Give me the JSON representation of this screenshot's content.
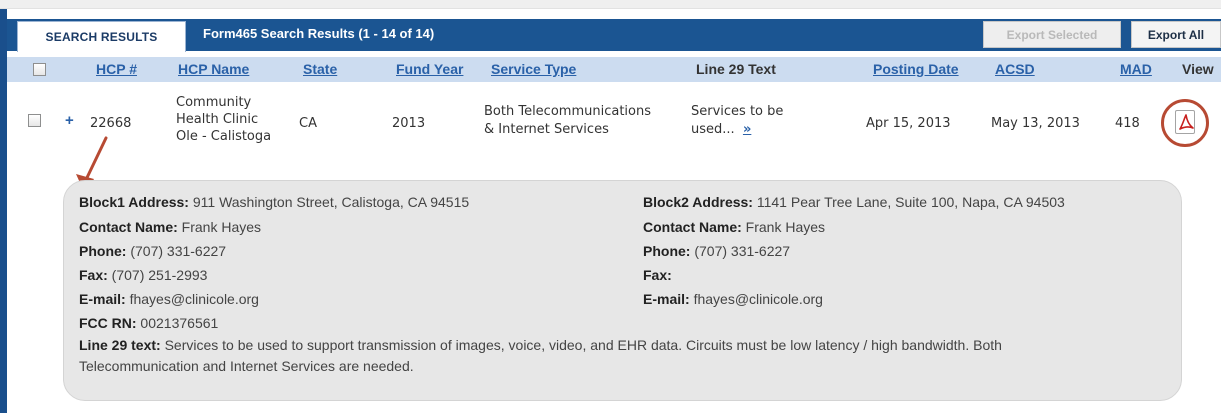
{
  "tabs": {
    "active": "SEARCH RESULTS"
  },
  "results": {
    "title": "Form465 Search Results (1 - 14 of 14)"
  },
  "toolbar": {
    "export_selected": "Export Selected",
    "export_all": "Export All"
  },
  "columns": {
    "hcp_num": "HCP #",
    "hcp_name": "HCP Name",
    "state": "State",
    "fund_year": "Fund Year",
    "service_type": "Service Type",
    "line29": "Line 29 Text",
    "posting_date": "Posting Date",
    "acsd": "ACSD",
    "mad": "MAD",
    "view": "View"
  },
  "row": {
    "expand_symbol": "+",
    "hcp_num": "22668",
    "hcp_name_1": "Community",
    "hcp_name_2": "Health Clinic",
    "hcp_name_3": "Ole - Calistoga",
    "state": "CA",
    "fund_year": "2013",
    "service_type_1": "Both Telecommunications",
    "service_type_2": "& Internet Services",
    "line29_1": "Services to be",
    "line29_2": "used...",
    "more_link": "»",
    "posting_date": "Apr 15, 2013",
    "acsd": "May 13, 2013",
    "mad": "418"
  },
  "details": {
    "block1_address_label": "Block1 Address:",
    "block1_address": " 911 Washington Street, Calistoga, CA 94515",
    "contact1_label": "Contact Name:",
    "contact1": " Frank Hayes",
    "phone1_label": "Phone:",
    "phone1": " (707) 331-6227",
    "fax1_label": "Fax:",
    "fax1": " (707) 251-2993",
    "email1_label": "E-mail:",
    "email1": " fhayes@clinicole.org",
    "fccrn_label": "FCC RN:",
    "fccrn": " 0021376561",
    "block2_address_label": "Block2 Address:",
    "block2_address": " 1141 Pear Tree Lane, Suite 100, Napa, CA 94503",
    "contact2_label": "Contact Name:",
    "contact2": " Frank Hayes",
    "phone2_label": "Phone:",
    "phone2": " (707) 331-6227",
    "fax2_label": "Fax:",
    "email2_label": "E-mail:",
    "email2": " fhayes@clinicole.org",
    "line29_label": "Line 29 text:",
    "line29_text": " Services to be used to support transmission of images, voice, video, and EHR data. Circuits must be low latency / high bandwidth. Both Telecommunication and Internet Services are needed."
  },
  "icons": {
    "view": "pdf-icon",
    "annotation": "arrow-icon",
    "highlight": "circle-highlight"
  },
  "colors": {
    "header_blue": "#1b5592",
    "column_header_bg": "#ccdcf0",
    "link_blue": "#2a61a8",
    "annotation_red": "#b74a33",
    "details_bg": "#e7e7e7"
  }
}
